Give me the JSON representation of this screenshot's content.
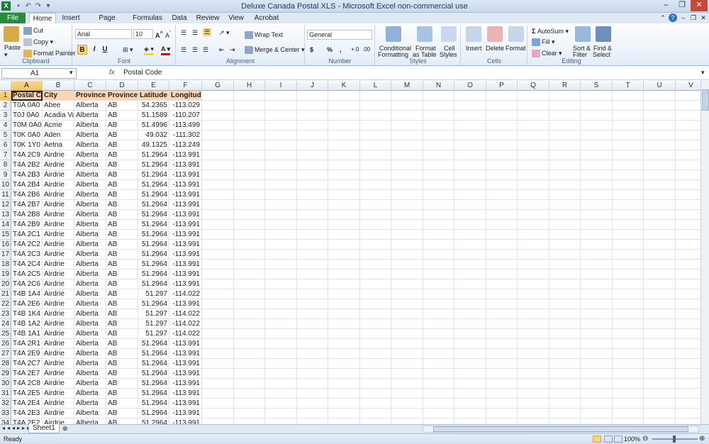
{
  "window": {
    "title": "Deluxe Canada Postal XLS  -  Microsoft Excel non-commercial use"
  },
  "tabs": {
    "file": "File",
    "items": [
      "Home",
      "Insert",
      "Page Layout",
      "Formulas",
      "Data",
      "Review",
      "View",
      "Acrobat"
    ],
    "active": "Home"
  },
  "ribbon": {
    "clipboard": {
      "label": "Clipboard",
      "paste": "Paste",
      "cut": "Cut",
      "copy": "Copy",
      "format_painter": "Format Painter"
    },
    "font": {
      "label": "Font",
      "name": "Arial",
      "size": "10",
      "bold": "B",
      "italic": "I",
      "underline": "U"
    },
    "alignment": {
      "label": "Alignment",
      "wrap_text": "Wrap Text",
      "merge_center": "Merge & Center"
    },
    "number": {
      "label": "Number",
      "format": "General",
      "currency": "$",
      "percent": "%",
      "comma": ","
    },
    "styles": {
      "label": "Styles",
      "conditional": "Conditional",
      "conditional2": "Formatting",
      "format_table": "Format",
      "format_table2": "as Table",
      "cell_styles": "Cell",
      "cell_styles2": "Styles"
    },
    "cells": {
      "label": "Cells",
      "insert": "Insert",
      "delete": "Delete",
      "format": "Format"
    },
    "editing": {
      "label": "Editing",
      "autosum": "AutoSum",
      "fill": "Fill",
      "clear": "Clear",
      "sort": "Sort &",
      "sort2": "Filter",
      "find": "Find &",
      "find2": "Select"
    }
  },
  "formula_bar": {
    "name_box": "A1",
    "fx": "fx",
    "content": "Postal Code"
  },
  "columns": [
    "A",
    "B",
    "C",
    "D",
    "E",
    "F",
    "G",
    "H",
    "I",
    "J",
    "K",
    "L",
    "M",
    "N",
    "O",
    "P",
    "Q",
    "R",
    "S",
    "T",
    "U",
    "V"
  ],
  "rows": [
    [
      "Postal Co",
      "City",
      "Province",
      "Province",
      "Latitude",
      "Longitude"
    ],
    [
      "T0A 0A0",
      "Abee",
      "Alberta",
      "AB",
      "54.2365",
      "-113.029"
    ],
    [
      "T0J 0A0",
      "Acadia Va",
      "Alberta",
      "AB",
      "51.1589",
      "-110.207"
    ],
    [
      "T0M 0A0",
      "Acme",
      "Alberta",
      "AB",
      "51.4996",
      "-113.499"
    ],
    [
      "T0K 0A0",
      "Aden",
      "Alberta",
      "AB",
      "49.032",
      "-111.302"
    ],
    [
      "T0K 1Y0",
      "Aetna",
      "Alberta",
      "AB",
      "49.1325",
      "-113.249"
    ],
    [
      "T4A 2C9",
      "Airdrie",
      "Alberta",
      "AB",
      "51.2964",
      "-113.991"
    ],
    [
      "T4A 2B2",
      "Airdrie",
      "Alberta",
      "AB",
      "51.2964",
      "-113.991"
    ],
    [
      "T4A 2B3",
      "Airdrie",
      "Alberta",
      "AB",
      "51.2964",
      "-113.991"
    ],
    [
      "T4A 2B4",
      "Airdrie",
      "Alberta",
      "AB",
      "51.2964",
      "-113.991"
    ],
    [
      "T4A 2B6",
      "Airdrie",
      "Alberta",
      "AB",
      "51.2964",
      "-113.991"
    ],
    [
      "T4A 2B7",
      "Airdrie",
      "Alberta",
      "AB",
      "51.2964",
      "-113.991"
    ],
    [
      "T4A 2B8",
      "Airdrie",
      "Alberta",
      "AB",
      "51.2964",
      "-113.991"
    ],
    [
      "T4A 2B9",
      "Airdrie",
      "Alberta",
      "AB",
      "51.2964",
      "-113.991"
    ],
    [
      "T4A 2C1",
      "Airdrie",
      "Alberta",
      "AB",
      "51.2964",
      "-113.991"
    ],
    [
      "T4A 2C2",
      "Airdrie",
      "Alberta",
      "AB",
      "51.2964",
      "-113.991"
    ],
    [
      "T4A 2C3",
      "Airdrie",
      "Alberta",
      "AB",
      "51.2964",
      "-113.991"
    ],
    [
      "T4A 2C4",
      "Airdrie",
      "Alberta",
      "AB",
      "51.2964",
      "-113.991"
    ],
    [
      "T4A 2C5",
      "Airdrie",
      "Alberta",
      "AB",
      "51.2964",
      "-113.991"
    ],
    [
      "T4A 2C6",
      "Airdrie",
      "Alberta",
      "AB",
      "51.2964",
      "-113.991"
    ],
    [
      "T4B 1A4",
      "Airdrie",
      "Alberta",
      "AB",
      "51.297",
      "-114.022"
    ],
    [
      "T4A 2E6",
      "Airdrie",
      "Alberta",
      "AB",
      "51.2964",
      "-113.991"
    ],
    [
      "T4B 1K4",
      "Airdrie",
      "Alberta",
      "AB",
      "51.297",
      "-114.022"
    ],
    [
      "T4B 1A2",
      "Airdrie",
      "Alberta",
      "AB",
      "51.297",
      "-114.022"
    ],
    [
      "T4B 1A1",
      "Airdrie",
      "Alberta",
      "AB",
      "51.297",
      "-114.022"
    ],
    [
      "T4A 2R1",
      "Airdrie",
      "Alberta",
      "AB",
      "51.2964",
      "-113.991"
    ],
    [
      "T4A 2E9",
      "Airdrie",
      "Alberta",
      "AB",
      "51.2964",
      "-113.991"
    ],
    [
      "T4A 2C7",
      "Airdrie",
      "Alberta",
      "AB",
      "51.2964",
      "-113.991"
    ],
    [
      "T4A 2E7",
      "Airdrie",
      "Alberta",
      "AB",
      "51.2964",
      "-113.991"
    ],
    [
      "T4A 2C8",
      "Airdrie",
      "Alberta",
      "AB",
      "51.2964",
      "-113.991"
    ],
    [
      "T4A 2E5",
      "Airdrie",
      "Alberta",
      "AB",
      "51.2964",
      "-113.991"
    ],
    [
      "T4A 2E4",
      "Airdrie",
      "Alberta",
      "AB",
      "51.2964",
      "-113.991"
    ],
    [
      "T4A 2E3",
      "Airdrie",
      "Alberta",
      "AB",
      "51.2964",
      "-113.991"
    ],
    [
      "T4A 2E2",
      "Airdrie",
      "Alberta",
      "AB",
      "51.2964",
      "-113.991"
    ]
  ],
  "sheet_tabs": [
    "Sheet1"
  ],
  "status": {
    "ready": "Ready",
    "zoom": "100%"
  },
  "colors": {
    "header_fill": "#fcd5b4",
    "file_tab": "#2a8a3e",
    "selected_header": "#f1c15f"
  }
}
